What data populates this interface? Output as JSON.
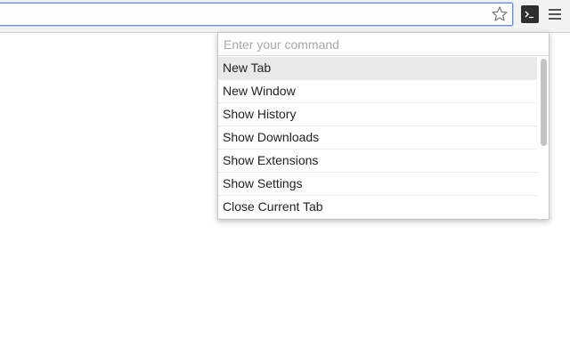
{
  "toolbar": {
    "star_icon": "star-icon",
    "extension_icon": "terminal-icon",
    "menu_icon": "hamburger-menu-icon"
  },
  "popup": {
    "input_placeholder": "Enter your command",
    "input_value": "",
    "items": [
      {
        "label": "New Tab"
      },
      {
        "label": "New Window"
      },
      {
        "label": "Show History"
      },
      {
        "label": "Show Downloads"
      },
      {
        "label": "Show Extensions"
      },
      {
        "label": "Show Settings"
      },
      {
        "label": "Close Current Tab"
      }
    ]
  },
  "colors": {
    "accent": "#6d8fe0",
    "selected_row": "#e9e9e9"
  }
}
